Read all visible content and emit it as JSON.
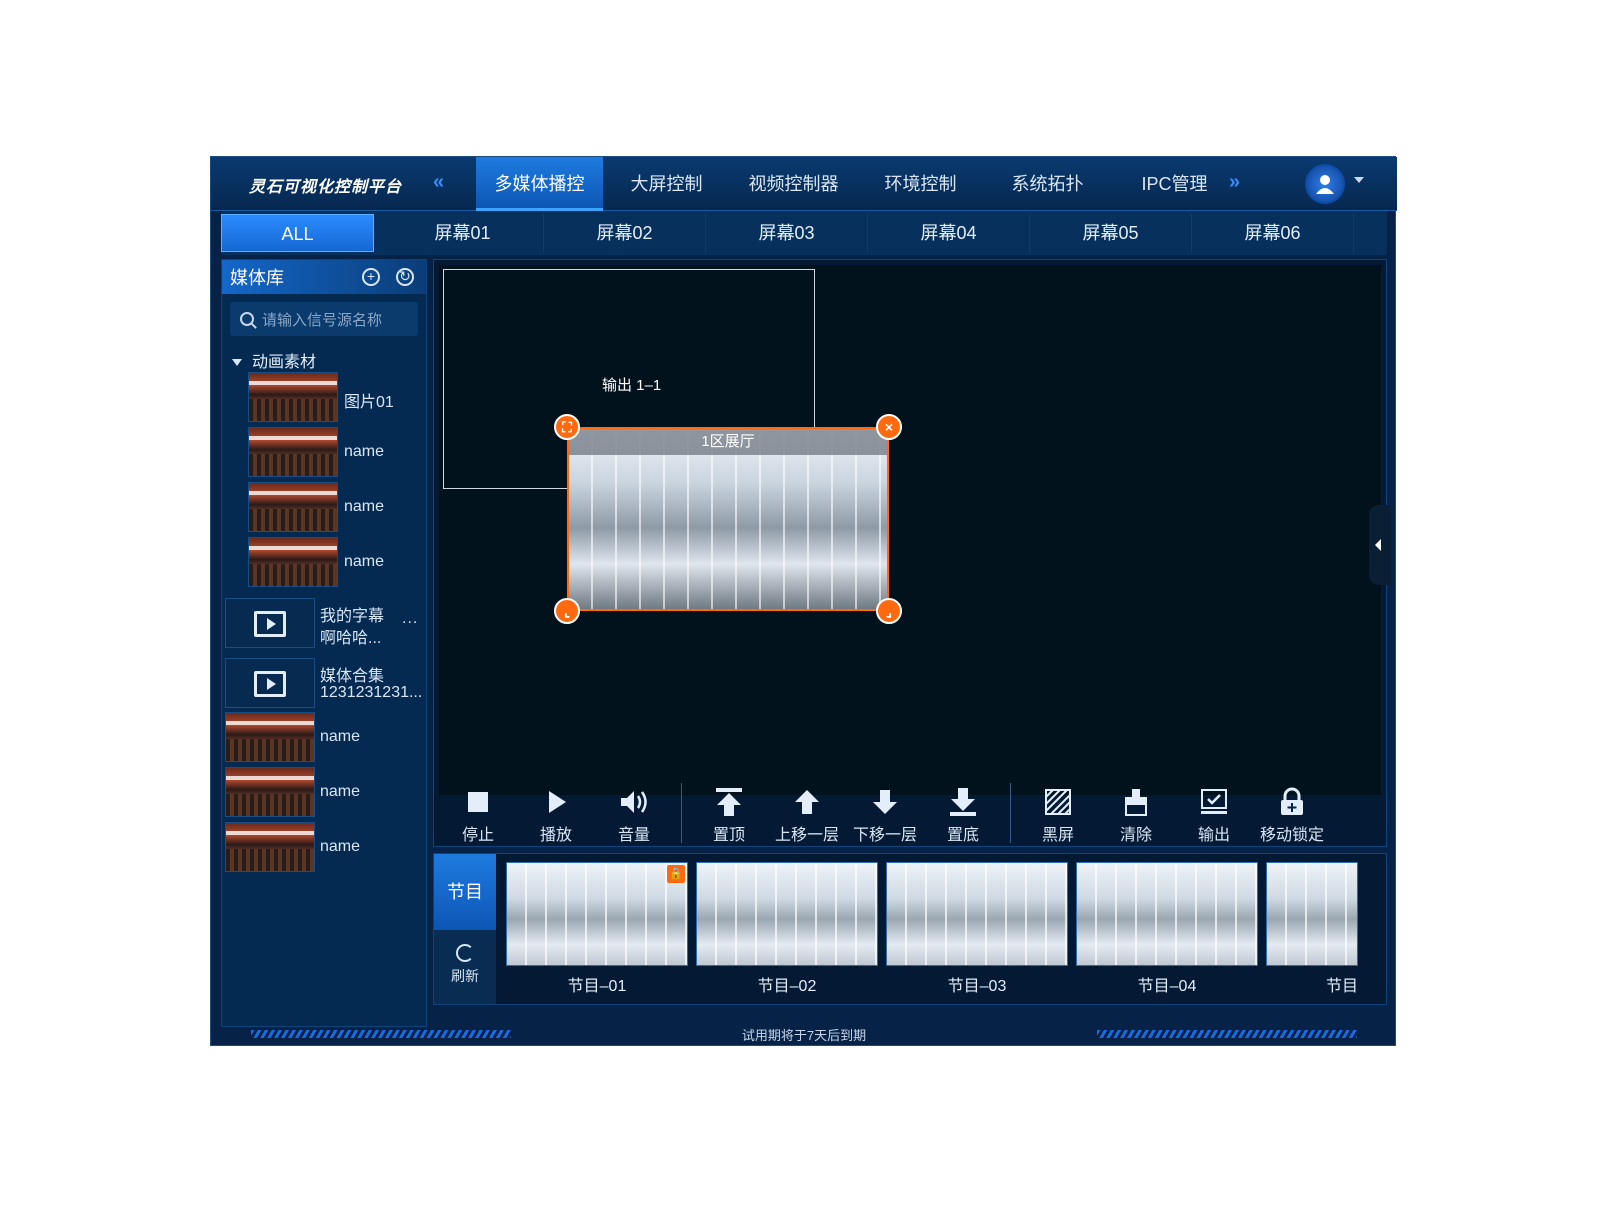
{
  "app": {
    "title": "灵石可视化控制平台",
    "footer": "试用期将于7天后到期"
  },
  "nav": {
    "tabs": [
      "多媒体播控",
      "大屏控制",
      "视频控制器",
      "环境控制",
      "系统拓扑",
      "IPC管理"
    ],
    "active_index": 0
  },
  "screens": {
    "tabs": [
      "ALL",
      "屏幕01",
      "屏幕02",
      "屏幕03",
      "屏幕04",
      "屏幕05",
      "屏幕06"
    ],
    "active_index": 0
  },
  "library": {
    "title": "媒体库",
    "search_placeholder": "请输入信号源名称",
    "group": "动画素材",
    "group_items": [
      "图片01",
      "name",
      "name",
      "name"
    ],
    "subtitle_item": {
      "line1": "我的字幕",
      "line2": "啊哈哈..."
    },
    "collection_item": {
      "line1": "媒体合集",
      "line2": "1231231231..."
    },
    "more": "...",
    "extra_items": [
      "name",
      "name",
      "name"
    ]
  },
  "canvas": {
    "output_label": "输出 1–1",
    "window_title": "1区展厅"
  },
  "toolbar": [
    "停止",
    "播放",
    "音量",
    "置顶",
    "上移一层",
    "下移一层",
    "置底",
    "黑屏",
    "清除",
    "输出",
    "移动锁定"
  ],
  "programs": {
    "tab": "节目",
    "refresh": "刷新",
    "items": [
      "节目–01",
      "节目–02",
      "节目–03",
      "节目–04",
      "节目"
    ]
  },
  "colors": {
    "accent": "#1f7be0",
    "handle": "#ff6a10",
    "panel": "#062347"
  }
}
